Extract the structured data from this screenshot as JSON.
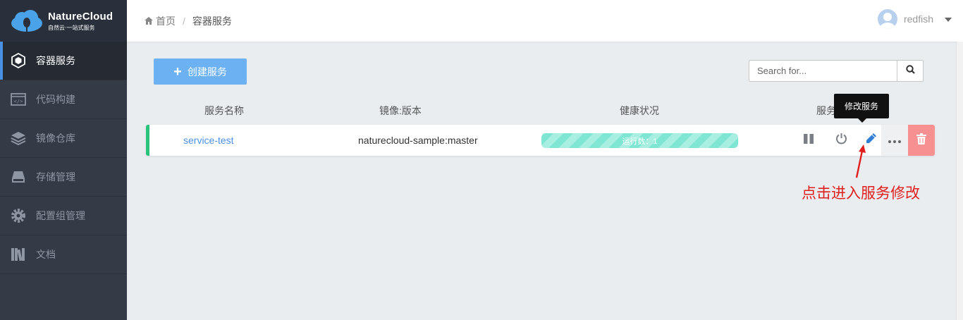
{
  "app": {
    "logo_title": "NatureCloud",
    "logo_subtitle": "自然云·一站式服务"
  },
  "sidebar": {
    "items": [
      {
        "label": "容器服务",
        "icon": "container-icon",
        "active": true
      },
      {
        "label": "代码构建",
        "icon": "code-icon",
        "active": false
      },
      {
        "label": "镜像仓库",
        "icon": "layers-icon",
        "active": false
      },
      {
        "label": "存储管理",
        "icon": "storage-icon",
        "active": false
      },
      {
        "label": "配置组管理",
        "icon": "gear-icon",
        "active": false
      },
      {
        "label": "文档",
        "icon": "books-icon",
        "active": false
      }
    ]
  },
  "header": {
    "breadcrumb": {
      "home": "首页",
      "separator": "/",
      "current": "容器服务"
    },
    "user": {
      "name": "redfish"
    }
  },
  "toolbar": {
    "create_label": "创建服务",
    "search_placeholder": "Search for..."
  },
  "table": {
    "columns": [
      "服务名称",
      "镜像:版本",
      "健康状况",
      "服务"
    ],
    "rows": [
      {
        "name": "service-test",
        "image": "naturecloud-sample:master",
        "health": "运行数：1",
        "status_color": "#2ac37b"
      }
    ]
  },
  "tooltip": {
    "text": "修改服务"
  },
  "annotation": {
    "text": "点击进入服务修改",
    "color": "#e01e1e"
  },
  "colors": {
    "accent": "#4a90e2",
    "create_button": "#6cb2f2",
    "health_bar": "#7fe6d3",
    "delete_button": "#f79191",
    "sidebar": "#343a46"
  }
}
